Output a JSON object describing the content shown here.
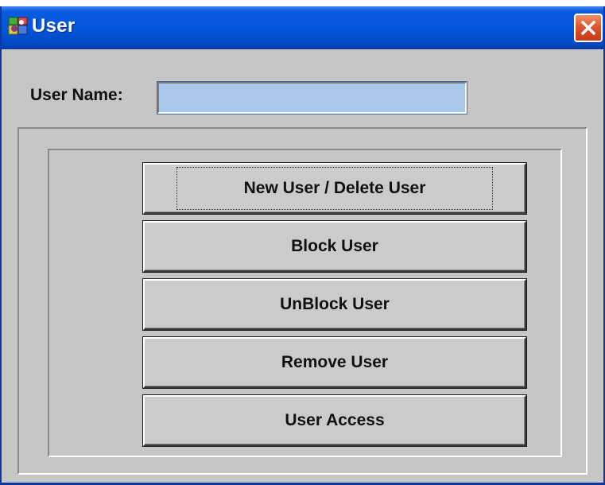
{
  "window": {
    "title": "User",
    "icon": "users-app-icon",
    "close_icon": "close-x-icon",
    "accent": "#0556dc",
    "close_color": "#e0552f"
  },
  "form": {
    "username_label": "User Name:",
    "username_value": "",
    "username_placeholder": "",
    "field_color": "#a9c8ec"
  },
  "actions": [
    {
      "label": "New User / Delete User",
      "focused": true
    },
    {
      "label": "Block User",
      "focused": false
    },
    {
      "label": "UnBlock User",
      "focused": false
    },
    {
      "label": "Remove User",
      "focused": false
    },
    {
      "label": "User Access",
      "focused": false
    }
  ]
}
